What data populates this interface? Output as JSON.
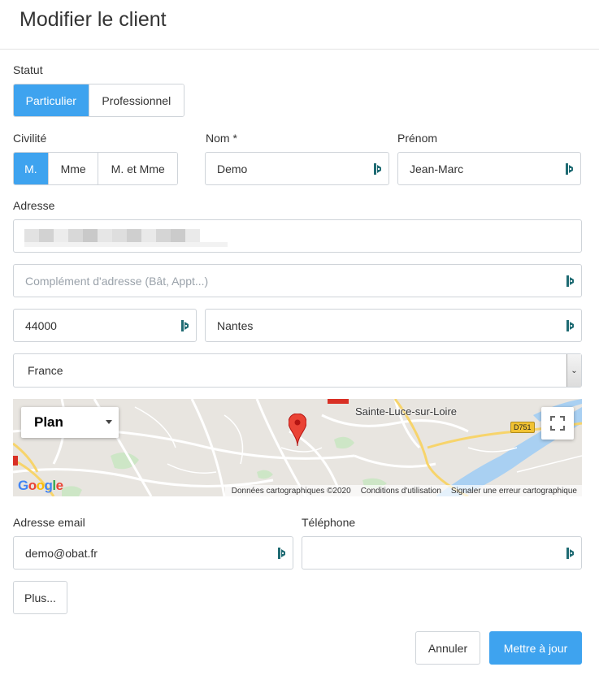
{
  "header": {
    "title": "Modifier le client"
  },
  "statut": {
    "label": "Statut",
    "options": [
      "Particulier",
      "Professionnel"
    ],
    "selected": "Particulier"
  },
  "civilite": {
    "label": "Civilité",
    "options": [
      "M.",
      "Mme",
      "M. et Mme"
    ],
    "selected": "M."
  },
  "nom": {
    "label": "Nom *",
    "value": "Demo"
  },
  "prenom": {
    "label": "Prénom",
    "value": "Jean-Marc"
  },
  "adresse": {
    "label": "Adresse",
    "value": "",
    "complement_placeholder": "Complément d'adresse (Bât, Appt...)",
    "postal_code": "44000",
    "city": "Nantes",
    "country": "France"
  },
  "map": {
    "map_type": "Plan",
    "place_label": "Sainte-Luce-sur-Loire",
    "road_label": "D751",
    "logo": "Google",
    "attribution": [
      "Données cartographiques ©2020",
      "Conditions d'utilisation",
      "Signaler une erreur cartographique"
    ],
    "marker_icon": "map-pin-icon",
    "fullscreen_icon": "fullscreen-icon"
  },
  "email": {
    "label": "Adresse email",
    "value": "demo@obat.fr"
  },
  "telephone": {
    "label": "Téléphone",
    "value": ""
  },
  "more_button": "Plus...",
  "footer": {
    "cancel": "Annuler",
    "submit": "Mettre à jour"
  },
  "colors": {
    "primary": "#3ea3ef",
    "border": "#cfd4d9",
    "keeper_icon": "#1f6b73"
  }
}
